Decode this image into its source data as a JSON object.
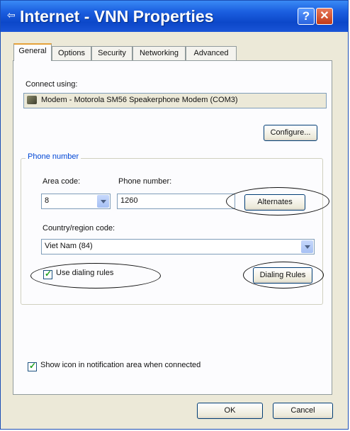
{
  "window": {
    "title": "Internet - VNN Properties",
    "help_glyph": "?",
    "close_glyph": "✕"
  },
  "tabs": [
    {
      "label": "General",
      "active": true
    },
    {
      "label": "Options",
      "active": false
    },
    {
      "label": "Security",
      "active": false
    },
    {
      "label": "Networking",
      "active": false
    },
    {
      "label": "Advanced",
      "active": false
    }
  ],
  "connect_using": {
    "label": "Connect using:",
    "device": "Modem - Motorola SM56 Speakerphone Modem (COM3)",
    "configure_button": "Configure..."
  },
  "phone_number": {
    "group_label": "Phone number",
    "area_code_label": "Area code:",
    "area_code_value": "8",
    "phone_label": "Phone number:",
    "phone_value": "1260",
    "alternates_button": "Alternates",
    "country_label": "Country/region code:",
    "country_value": "Viet Nam (84)",
    "use_dialing_rules_label": "Use dialing rules",
    "use_dialing_rules_checked": true,
    "dialing_rules_button": "Dialing Rules"
  },
  "show_icon": {
    "label": "Show icon in notification area when connected",
    "checked": true
  },
  "footer": {
    "ok_button": "OK",
    "cancel_button": "Cancel"
  },
  "colors": {
    "titlebar": "#0c47c9",
    "group_label": "#0046d5",
    "tab_highlight": "#e6a23b"
  }
}
